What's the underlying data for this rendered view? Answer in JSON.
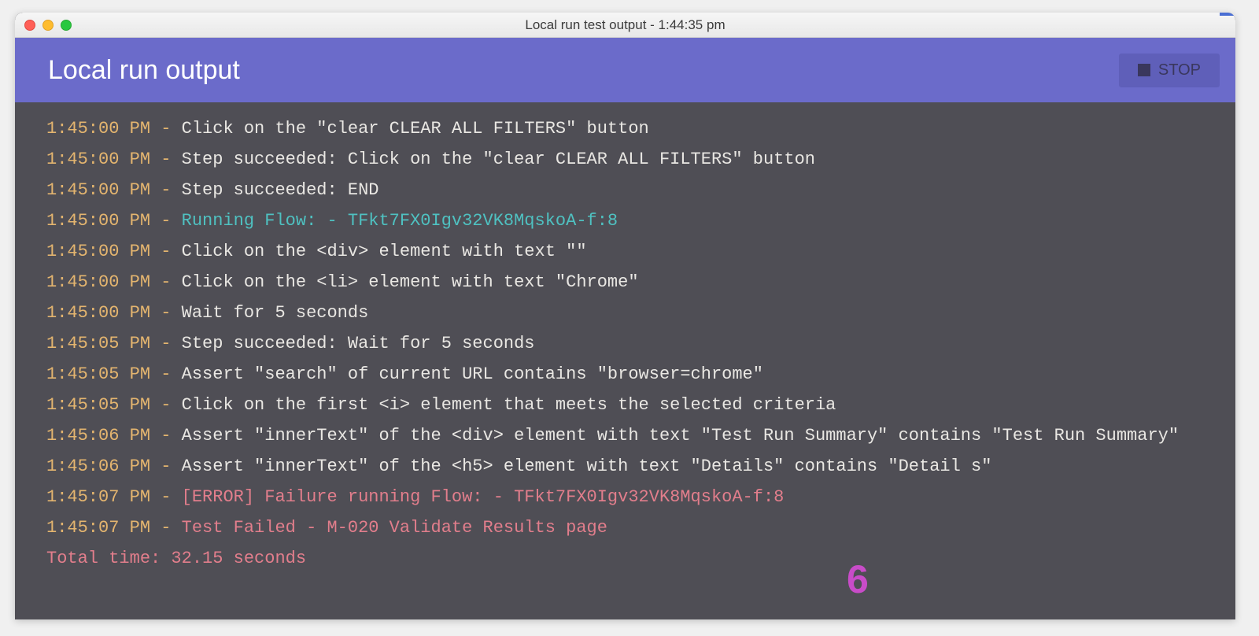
{
  "window": {
    "title": "Local run test output - 1:44:35 pm"
  },
  "header": {
    "title": "Local run output",
    "stop_label": "STOP"
  },
  "annotation": "6",
  "log": [
    {
      "ts": "1:45:00 PM",
      "class": "",
      "msg": "Click on the \"clear CLEAR ALL FILTERS\" button"
    },
    {
      "ts": "1:45:00 PM",
      "class": "",
      "msg": "Step succeeded: Click on the \"clear CLEAR ALL FILTERS\" button"
    },
    {
      "ts": "1:45:00 PM",
      "class": "",
      "msg": "Step succeeded: END"
    },
    {
      "ts": "1:45:00 PM",
      "class": "cyan",
      "msg": "Running Flow: - TFkt7FX0Igv32VK8MqskoA-f:8"
    },
    {
      "ts": "1:45:00 PM",
      "class": "",
      "msg": "Click on the <div> element with text \"\""
    },
    {
      "ts": "1:45:00 PM",
      "class": "",
      "msg": "Click on the <li> element with text \"Chrome\""
    },
    {
      "ts": "1:45:00 PM",
      "class": "",
      "msg": "Wait for 5 seconds"
    },
    {
      "ts": "1:45:05 PM",
      "class": "",
      "msg": "Step succeeded: Wait for 5 seconds"
    },
    {
      "ts": "1:45:05 PM",
      "class": "",
      "msg": "Assert \"search\" of current URL contains \"browser=chrome\""
    },
    {
      "ts": "1:45:05 PM",
      "class": "",
      "msg": "Click on the first <i> element that meets the selected criteria"
    },
    {
      "ts": "1:45:06 PM",
      "class": "",
      "msg": "Assert \"innerText\" of the <div> element with text \"Test Run Summary\" contains \"Test Run Summary\""
    },
    {
      "ts": "1:45:06 PM",
      "class": "",
      "msg": "Assert \"innerText\" of the <h5> element with text \"Details\" contains \"Detail s\""
    },
    {
      "ts": "1:45:07 PM",
      "class": "pink",
      "msg": "[ERROR] Failure running Flow: - TFkt7FX0Igv32VK8MqskoA-f:8"
    },
    {
      "ts": "1:45:07 PM",
      "class": "pink",
      "msg": "Test Failed - M-020 Validate Results page"
    }
  ],
  "footer": {
    "total_time": "Total time: 32.15 seconds"
  }
}
